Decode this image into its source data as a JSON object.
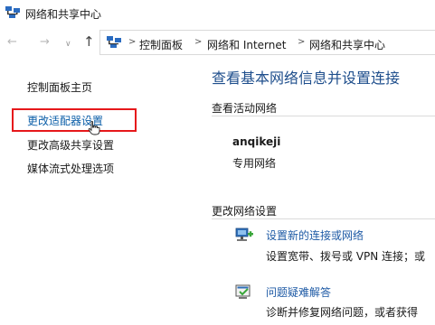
{
  "window": {
    "title": "网络和共享中心"
  },
  "nav": {
    "back": "←",
    "forward": "→",
    "recent": "∨",
    "up": "↑"
  },
  "address": {
    "separator": ">",
    "crumbs": [
      "控制面板",
      "网络和 Internet",
      "网络和共享中心"
    ]
  },
  "sidebar": {
    "home": "控制面板主页",
    "links": [
      "更改适配器设置",
      "更改高级共享设置",
      "媒体流式处理选项"
    ]
  },
  "main": {
    "title": "查看基本网络信息并设置连接",
    "active_networks_label": "查看活动网络",
    "network": {
      "name": "anqikeji",
      "type": "专用网络"
    },
    "change_settings_label": "更改网络设置",
    "tasks": [
      {
        "link": "设置新的连接或网络",
        "desc": "设置宽带、拨号或 VPN 连接；或"
      },
      {
        "link": "问题疑难解答",
        "desc": "诊断并修复网络问题，或者获得"
      }
    ]
  }
}
